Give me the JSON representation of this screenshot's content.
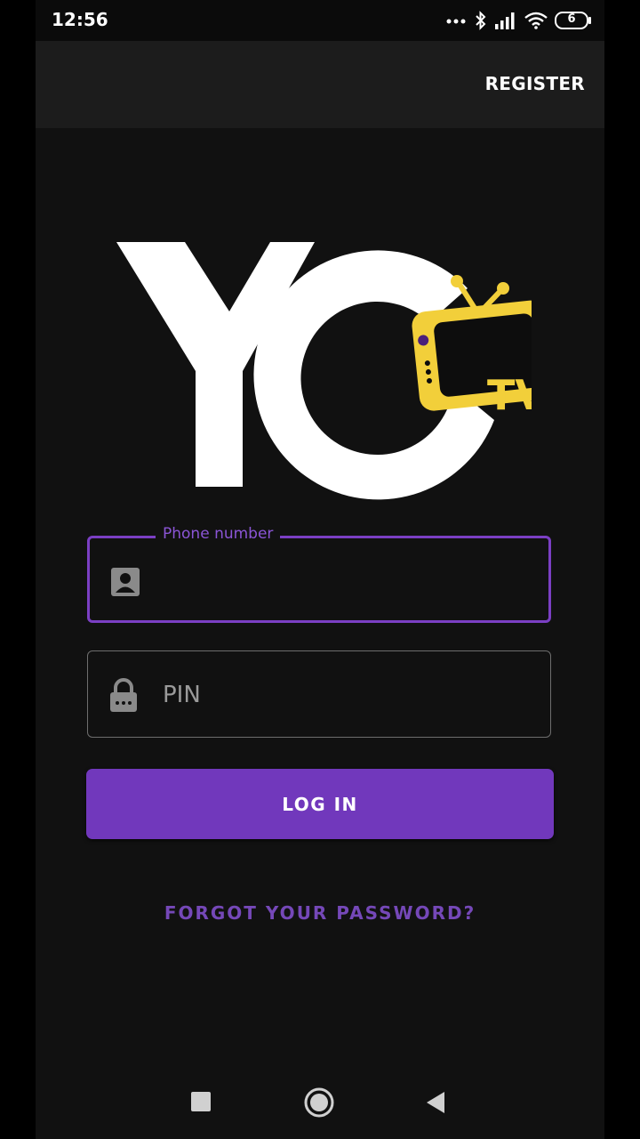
{
  "status_bar": {
    "time": "12:56",
    "battery_level": "6",
    "icons": [
      "more-dots-icon",
      "bluetooth-icon",
      "signal-icon",
      "wifi-icon",
      "battery-icon"
    ]
  },
  "app_bar": {
    "register_label": "REGISTER"
  },
  "logo": {
    "brand_text": "YC",
    "tv_text": "TV",
    "colors": {
      "letters": "#ffffff",
      "tv": "#f2cf3a",
      "accent": "#4a1f7a"
    }
  },
  "form": {
    "phone": {
      "label": "Phone number",
      "value": "",
      "icon": "contact-card-icon"
    },
    "pin": {
      "placeholder": "PIN",
      "value": "",
      "icon": "lock-icon"
    },
    "login_label": "LOG IN",
    "forgot_label": "FORGOT YOUR PASSWORD?"
  },
  "nav": {
    "buttons": [
      "recents-square-icon",
      "home-circle-icon",
      "back-triangle-icon"
    ]
  },
  "colors": {
    "accent": "#7138bc",
    "background": "#111111",
    "app_bar": "#1c1c1c",
    "link": "#7548b8"
  }
}
